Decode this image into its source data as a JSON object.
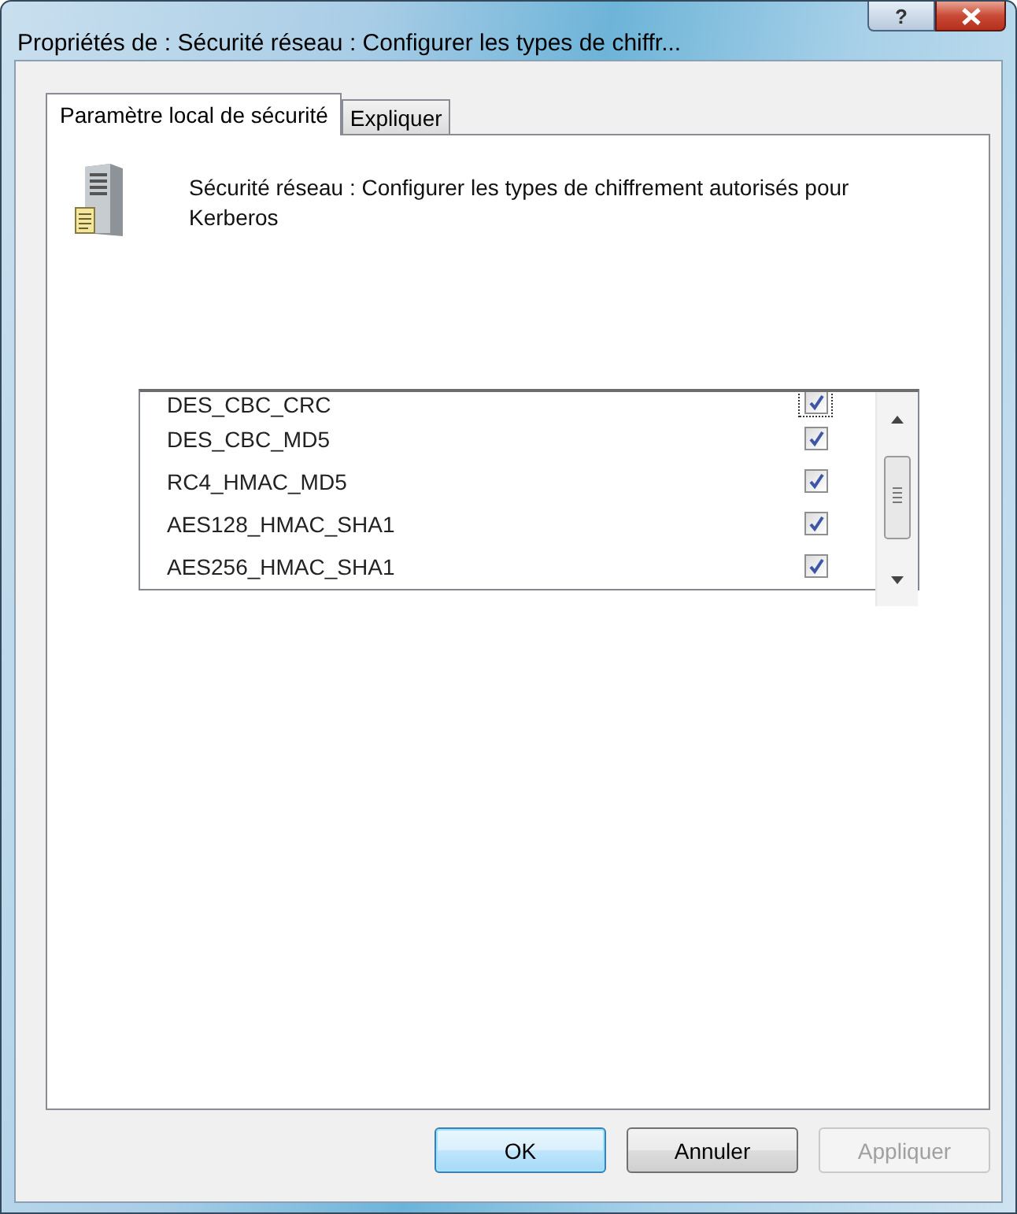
{
  "window": {
    "title": "Propriétés de : Sécurité réseau : Configurer les types de chiffr...",
    "help_button": "?"
  },
  "tabs": [
    {
      "label": "Paramètre local de sécurité",
      "selected": true
    },
    {
      "label": "Expliquer",
      "selected": false
    }
  ],
  "description": "Sécurité réseau : Configurer les types de chiffrement autorisés pour Kerberos",
  "list": {
    "items": [
      {
        "label": "DES_CBC_CRC",
        "checked": true,
        "focused": true
      },
      {
        "label": "DES_CBC_MD5",
        "checked": true,
        "focused": false
      },
      {
        "label": "RC4_HMAC_MD5",
        "checked": true,
        "focused": false
      },
      {
        "label": "AES128_HMAC_SHA1",
        "checked": true,
        "focused": false
      },
      {
        "label": "AES256_HMAC_SHA1",
        "checked": true,
        "focused": false
      }
    ]
  },
  "buttons": [
    {
      "label": "OK",
      "default": true,
      "disabled": false
    },
    {
      "label": "Annuler",
      "default": false,
      "disabled": false
    },
    {
      "label": "Appliquer",
      "default": false,
      "disabled": true
    }
  ]
}
